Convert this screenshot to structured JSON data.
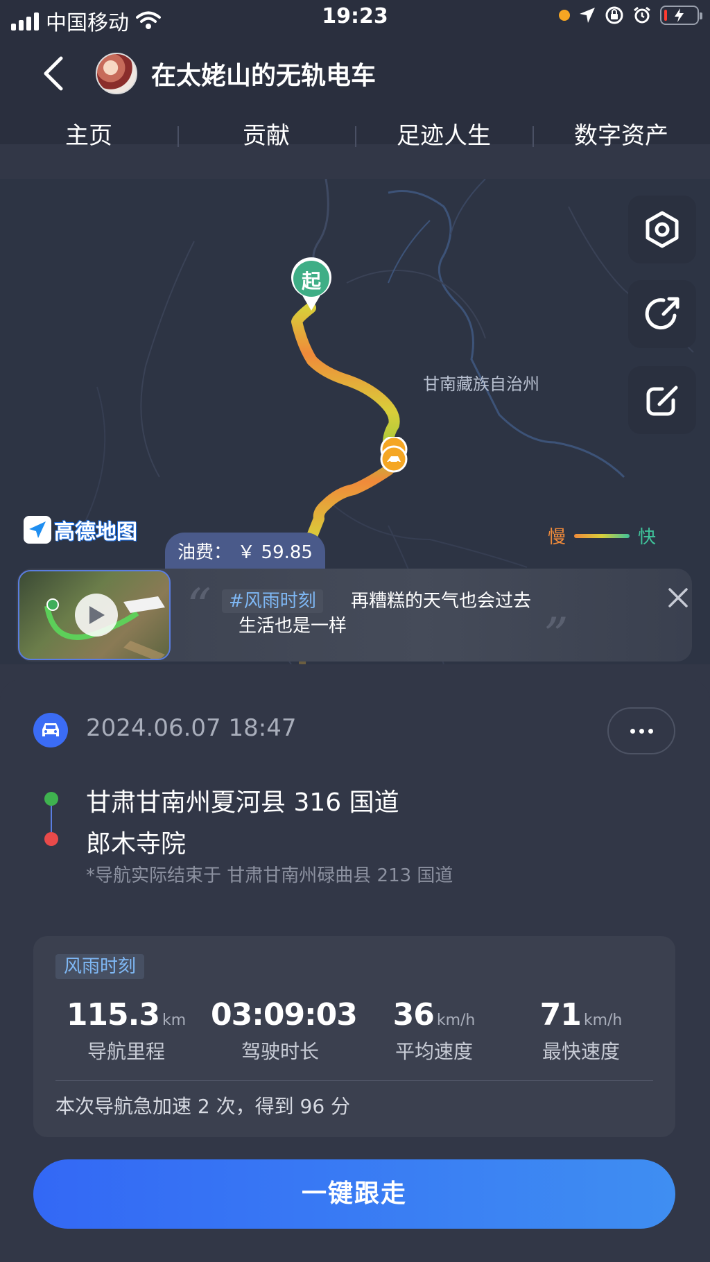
{
  "status_bar": {
    "carrier": "中国移动",
    "time": "19:23",
    "icons": [
      "signal-icon",
      "wifi-icon",
      "recording-dot-icon",
      "location-arrow-icon",
      "rotation-lock-icon",
      "alarm-icon",
      "battery-charging-icon"
    ],
    "battery_level": 0.1
  },
  "header": {
    "title": "在太姥山的无轨电车"
  },
  "tabs": [
    {
      "label": "主页"
    },
    {
      "label": "贡献"
    },
    {
      "label": "足迹人生"
    },
    {
      "label": "数字资产"
    }
  ],
  "map": {
    "start_marker": "起",
    "region_label": "甘南藏族自治州",
    "provider_logo": "高德地图",
    "legend": {
      "slow": "慢",
      "fast": "快"
    },
    "fuel_cost": "油费： ￥ 59.85",
    "side_buttons": [
      "settings-hexagon-icon",
      "share-icon",
      "edit-icon"
    ],
    "colors": {
      "slow": "#f08a3a",
      "mid": "#d8cf3a",
      "fast": "#3fc29a"
    }
  },
  "moment": {
    "tag": "#风雨时刻",
    "line1": "再糟糕的天气也会过去",
    "line2": "生活也是一样"
  },
  "trip": {
    "datetime": "2024.06.07 18:47",
    "start": "甘肃甘南州夏河县 316 国道",
    "end": "郎木寺院",
    "note": "*导航实际结束于 甘肃甘南州碌曲县 213 国道"
  },
  "stats": {
    "tag": "风雨时刻",
    "items": [
      {
        "value": "115.3",
        "unit": "km",
        "label": "导航里程"
      },
      {
        "value": "03:09:03",
        "unit": "",
        "label": "驾驶时长"
      },
      {
        "value": "36",
        "unit": "km/h",
        "label": "平均速度"
      },
      {
        "value": "71",
        "unit": "km/h",
        "label": "最快速度"
      }
    ],
    "summary": "本次导航急加速 2 次，得到 96 分"
  },
  "cta": {
    "label": "一键跟走"
  },
  "colors": {
    "accent": "#3b6cf5",
    "background": "#323747"
  }
}
